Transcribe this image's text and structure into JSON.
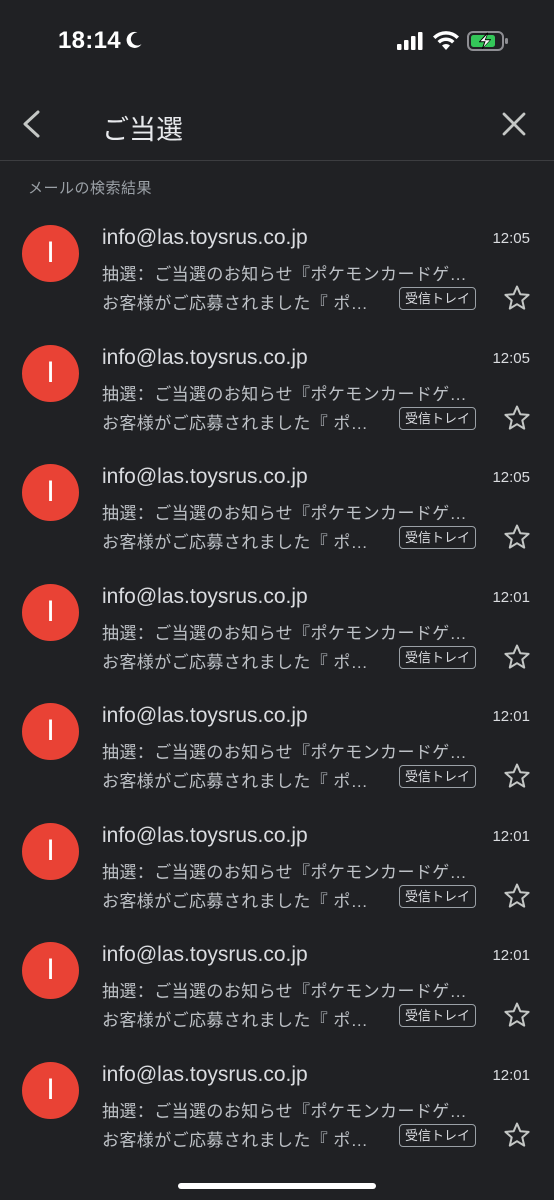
{
  "status_bar": {
    "time": "18:14",
    "icons": [
      "moon-icon",
      "signal-icon",
      "wifi-icon",
      "battery-charging-icon"
    ]
  },
  "header": {
    "query": "ご当選",
    "icons": [
      "back-icon",
      "close-icon"
    ]
  },
  "section_label": "メールの検索結果",
  "colors": {
    "background": "#202124",
    "avatar": "#e94235"
  },
  "emails": [
    {
      "avatar_letter": "I",
      "sender": "info@las.toysrus.co.jp",
      "time": "12:05",
      "subject": "抽選：ご当選のお知らせ『ポケモンカードゲ…",
      "snippet": "お客様がご応募されました『 ポ…",
      "label": "受信トレイ"
    },
    {
      "avatar_letter": "I",
      "sender": "info@las.toysrus.co.jp",
      "time": "12:05",
      "subject": "抽選：ご当選のお知らせ『ポケモンカードゲ…",
      "snippet": "お客様がご応募されました『 ポ…",
      "label": "受信トレイ"
    },
    {
      "avatar_letter": "I",
      "sender": "info@las.toysrus.co.jp",
      "time": "12:05",
      "subject": "抽選：ご当選のお知らせ『ポケモンカードゲ…",
      "snippet": "お客様がご応募されました『 ポ…",
      "label": "受信トレイ"
    },
    {
      "avatar_letter": "I",
      "sender": "info@las.toysrus.co.jp",
      "time": "12:01",
      "subject": "抽選：ご当選のお知らせ『ポケモンカードゲ…",
      "snippet": "お客様がご応募されました『 ポ…",
      "label": "受信トレイ"
    },
    {
      "avatar_letter": "I",
      "sender": "info@las.toysrus.co.jp",
      "time": "12:01",
      "subject": "抽選：ご当選のお知らせ『ポケモンカードゲ…",
      "snippet": "お客様がご応募されました『 ポ…",
      "label": "受信トレイ"
    },
    {
      "avatar_letter": "I",
      "sender": "info@las.toysrus.co.jp",
      "time": "12:01",
      "subject": "抽選：ご当選のお知らせ『ポケモンカードゲ…",
      "snippet": "お客様がご応募されました『 ポ…",
      "label": "受信トレイ"
    },
    {
      "avatar_letter": "I",
      "sender": "info@las.toysrus.co.jp",
      "time": "12:01",
      "subject": "抽選：ご当選のお知らせ『ポケモンカードゲ…",
      "snippet": "お客様がご応募されました『 ポ…",
      "label": "受信トレイ"
    },
    {
      "avatar_letter": "I",
      "sender": "info@las.toysrus.co.jp",
      "time": "12:01",
      "subject": "抽選：ご当選のお知らせ『ポケモンカードゲ…",
      "snippet": "お客様がご応募されました『 ポ…",
      "label": "受信トレイ"
    }
  ]
}
